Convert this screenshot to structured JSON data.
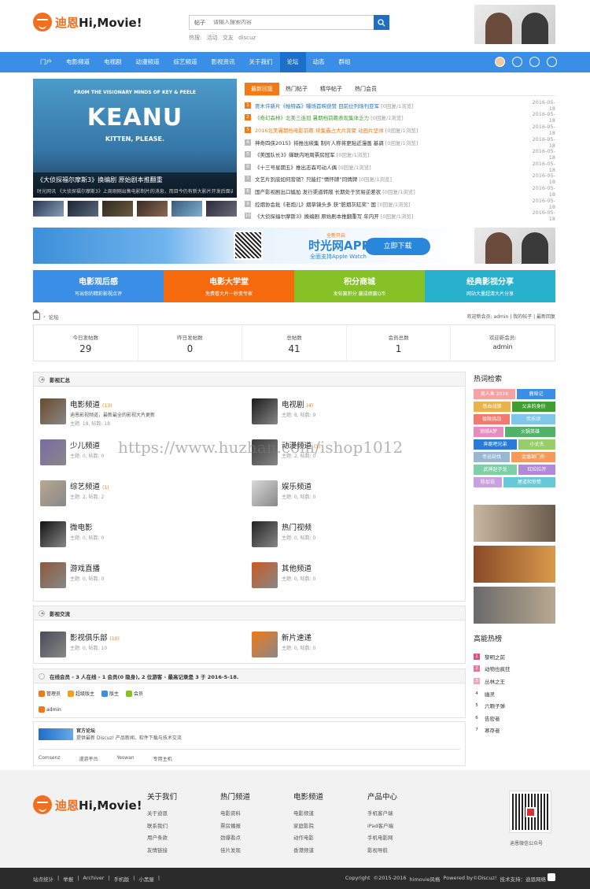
{
  "logo": {
    "text_cn": "迪恩",
    "text_en": "Hi,Movie!"
  },
  "search": {
    "select_label": "帖子",
    "placeholder": "请输入搜索内容"
  },
  "hot_search": {
    "label": "热搜:",
    "items": [
      "活动",
      "交友",
      "discuz"
    ]
  },
  "nav": {
    "items": [
      "门户",
      "电影频道",
      "电视剧",
      "动漫频道",
      "综艺频道",
      "影视资讯",
      "关于我们",
      "论坛",
      "动态",
      "群组"
    ],
    "active_index": 7
  },
  "banner": {
    "tagline": "FROM THE VISIONARY MINDS OF KEY & PEELE",
    "title": "KEANU",
    "subtitle": "KITTEN, PLEASE.",
    "caption_title": "《大侦探福尔摩斯3》换编剧 原始剧本推翻重",
    "caption_desc": "时光网讯 《大侦探福尔摩斯3》上周刚刚出售电影制片的消息，而目今仍有新大影片开发后面调"
  },
  "news_tabs": [
    "最新回复",
    "热门帖子",
    "精华帖子",
    "热门会员"
  ],
  "news": [
    {
      "n": "1",
      "title": "贾木许新片《帕特森》曝场首映获赞 目前位列场刊亚军",
      "meta": "[0回复/1浏览]",
      "date": "2016-05-18",
      "color": "blue"
    },
    {
      "n": "2",
      "title": "《奇幻森林》北美三连冠 暑期档前瞻表现集体乏力",
      "meta": "[0回复/1浏览]",
      "date": "2016-05-18",
      "color": "green"
    },
    {
      "n": "3",
      "title": "2016北美暑期档电影前瞻 续集霸占大片奔聚 动画片坚帅",
      "meta": "[0回复/1浏览]",
      "date": "2016-05-18",
      "color": "orange"
    },
    {
      "n": "4",
      "title": "神奇四侠2015》将推出续集 制片人称将更贴近漫画 基调",
      "meta": "[0回复/1浏览]",
      "date": "2016-05-18",
      "color": ""
    },
    {
      "n": "5",
      "title": "《美国队长3》蝉联内地周票房冠军",
      "meta": "[0回复/1浏览]",
      "date": "2016-05-18",
      "color": ""
    },
    {
      "n": "6",
      "title": "《十三号星期五》推出志森可动人偶",
      "meta": "[0回复/1浏览]",
      "date": "2016-05-18",
      "color": ""
    },
    {
      "n": "7",
      "title": "文艺片到底如何营销？只能打“情怀牌”同情牌",
      "meta": "[0回复/1浏览]",
      "date": "2016-05-18",
      "color": ""
    },
    {
      "n": "8",
      "title": "国产影视剧出口尴尬 发行渠道转敞 长期处于贸易逆差状",
      "meta": "[0回复/1浏览]",
      "date": "2016-05-18",
      "color": ""
    },
    {
      "n": "9",
      "title": "控烟协会批《老炮儿》烟草镜头多 获“脏烟灰缸奖” 国",
      "meta": "[0回复/1浏览]",
      "date": "2016-05-18",
      "color": ""
    },
    {
      "n": "10",
      "title": "《大侦探福尔摩斯3》换编剧 原始剧本推翻重写 年内开",
      "meta": "[0回复/1浏览]",
      "date": "2016-05-18",
      "color": ""
    }
  ],
  "app_ad": {
    "badge": "全新开启",
    "title": "时光网APP",
    "subtitle": "全面支持Apple Watch",
    "button": "立即下载"
  },
  "blocks": [
    {
      "title": "电影观后感",
      "sub": "写出你的精彩影视点评",
      "color": "#3b8ee6"
    },
    {
      "title": "电影大学堂",
      "sub": "免费看大片一秒变专家",
      "color": "#f56a0c"
    },
    {
      "title": "积分商城",
      "sub": "发帖赢积分 赢成绩赢Q币",
      "color": "#86c226"
    },
    {
      "title": "经典影视分享",
      "sub": "网站大量超清大片分享",
      "color": "#27b1cc"
    }
  ],
  "breadcrumb": {
    "separator": "›",
    "current": "论坛"
  },
  "welcome": "欢迎新会员: admin | 我的帖子 | 最新回复",
  "stats": [
    {
      "label": "今日发帖数",
      "value": "29"
    },
    {
      "label": "昨日发帖数",
      "value": "0"
    },
    {
      "label": "总帖数",
      "value": "41"
    },
    {
      "label": "会员总数",
      "value": "1"
    },
    {
      "label": "欢迎新会员:",
      "value": "admin"
    }
  ],
  "section1": {
    "title": "影视汇总"
  },
  "forums": [
    {
      "name": "电影频道",
      "count": "(13)",
      "desc": "迪恩影视频道，最新最全的影视大片更新",
      "meta": "主题: 18, 帖数: 18",
      "color": "#6a4a2a"
    },
    {
      "name": "电视剧",
      "count": "(4)",
      "desc": "",
      "meta": "主题: 8, 帖数: 9",
      "color": "#1a1a1a"
    },
    {
      "name": "少儿频道",
      "count": "",
      "desc": "",
      "meta": "主题: 0, 帖数: 0",
      "color": "#7a6aa8"
    },
    {
      "name": "动漫频道",
      "count": "(1)",
      "desc": "",
      "meta": "主题: 2, 帖数: 0",
      "color": "#3a3a3a"
    },
    {
      "name": "综艺频道",
      "count": "(1)",
      "desc": "",
      "meta": "主题: 2, 帖数: 2",
      "color": "#b8a890"
    },
    {
      "name": "娱乐频道",
      "count": "",
      "desc": "",
      "meta": "主题: 0, 帖数: 0",
      "color": "#d8d8d8"
    },
    {
      "name": "微电影",
      "count": "",
      "desc": "",
      "meta": "主题: 0, 帖数: 0",
      "color": "#111111"
    },
    {
      "name": "热门视频",
      "count": "",
      "desc": "",
      "meta": "主题: 0, 帖数: 0",
      "color": "#222222"
    },
    {
      "name": "游戏直播",
      "count": "",
      "desc": "",
      "meta": "主题: 0, 帖数: 0",
      "color": "#8a5a3a"
    },
    {
      "name": "其他频道",
      "count": "",
      "desc": "",
      "meta": "主题: 0, 帖数: 0",
      "color": "#c85a20"
    }
  ],
  "section2": {
    "title": "影视交流"
  },
  "forums2": [
    {
      "name": "影视俱乐部",
      "count": "(10)",
      "meta": "主题: 0, 帖数: 10",
      "color": "#4a4a5a"
    },
    {
      "name": "新片速递",
      "count": "",
      "meta": "主题: 0, 帖数: 0",
      "color": "#f07a17"
    }
  ],
  "online": {
    "title": "在线会员 - 3 人在线 - 1 会员(0 隐身), 2 位游客 - 最高记录是 3 于 2016-5-18.",
    "legend": [
      {
        "label": "管理员",
        "color": "#f07a17"
      },
      {
        "label": "超级版主",
        "color": "#f0a020"
      },
      {
        "label": "版主",
        "color": "#3b8ee6"
      },
      {
        "label": "会员",
        "color": "#86c226"
      }
    ],
    "user": "admin"
  },
  "friend_links": {
    "logo_text": "Discuz!",
    "title": "官方论坛",
    "desc": "提供最新 Discuz! 产品新闻、软件下载与技术交流",
    "links": [
      "Comsenz",
      "漫游平台",
      "Yeswan",
      "专用主机"
    ]
  },
  "side": {
    "hot_title": "热词检索",
    "tags": [
      {
        "t": "美人鱼 2016",
        "c": "#f5a2a2"
      },
      {
        "t": "鹿晗记",
        "c": "#3b8ee6"
      },
      {
        "t": "铁血战狼",
        "c": "#e8b34a"
      },
      {
        "t": "父亲的身份",
        "c": "#3f9e2f"
      },
      {
        "t": "极限挑战",
        "c": "#f07a70"
      },
      {
        "t": "欢乐颂",
        "c": "#7ec7e8"
      },
      {
        "t": "琅琊A梦",
        "c": "#e88cc0"
      },
      {
        "t": "火锅英雄",
        "c": "#52b26a"
      },
      {
        "t": "奔跑吧兄弟",
        "c": "#2a7ad8"
      },
      {
        "t": "小丈夫",
        "c": "#96cf6a"
      },
      {
        "t": "幸运劫伐",
        "c": "#9ab7d0"
      },
      {
        "t": "金盾部门外",
        "c": "#f59a5a"
      },
      {
        "t": "武神赵子龙",
        "c": "#7ecfa8"
      },
      {
        "t": "红拉拉开",
        "c": "#b08ad8"
      },
      {
        "t": "陈如说",
        "c": "#c9a0e0"
      },
      {
        "t": "屋道和惊慌",
        "c": "#68c8d8"
      }
    ],
    "rank_title": "高能热榜",
    "rank": [
      "黎明之前",
      "动物也疯狂",
      "丛林之王",
      "幽灵",
      "六颗子弹",
      "告密者",
      "寒存者"
    ]
  },
  "footer": {
    "cols": [
      {
        "h": "关于我们",
        "items": [
          "关于迪恩",
          "联系我们",
          "用户条款",
          "友情链接"
        ]
      },
      {
        "h": "热门频道",
        "items": [
          "电影资料",
          "票房播报",
          "劲爆看点",
          "佳片发现"
        ]
      },
      {
        "h": "电影频道",
        "items": [
          "电影频道",
          "家庭影院",
          "动作电影",
          "香港频道"
        ]
      },
      {
        "h": "产品中心",
        "items": [
          "手机客户端",
          "iPad客户端",
          "手机电影网",
          "影视导航"
        ]
      }
    ],
    "qr_caption": "迪恩微信公众号",
    "bottom_left": [
      "站点统计",
      "|",
      "举报",
      "|",
      "Archiver",
      "|",
      "手机版",
      "|",
      "小黑屋",
      "|"
    ],
    "bottom_right": [
      "Copyright",
      "©2015-2016",
      "himovie风格",
      "Powered by©Discuz!",
      "技术支持：迪恩网络"
    ]
  },
  "watermark": "https://www.huzhan.com/ishop1012"
}
